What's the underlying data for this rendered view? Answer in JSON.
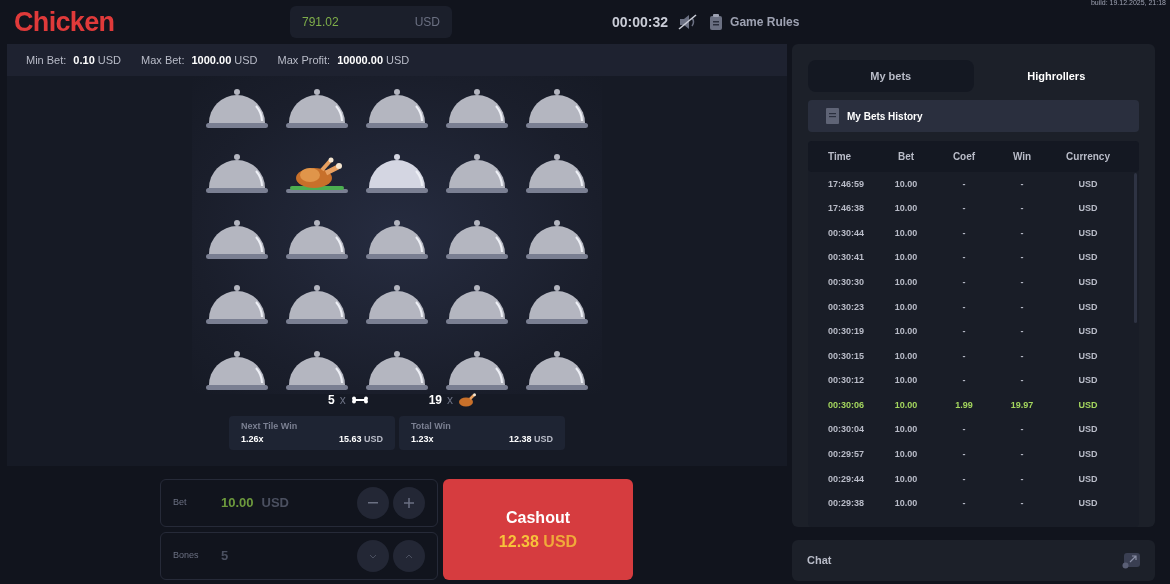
{
  "header": {
    "logo": "Chicken",
    "balance": {
      "amount": "791.02",
      "currency": "USD"
    },
    "timer": "00:00:32",
    "sound_muted": true,
    "rules_link": "Game Rules",
    "build": "build: 19.12.2025, 21:18"
  },
  "limits": [
    {
      "label": "Min Bet:",
      "value": "0.10",
      "currency": "USD"
    },
    {
      "label": "Max Bet:",
      "value": "1000.00",
      "currency": "USD"
    },
    {
      "label": "Max Profit:",
      "value": "10000.00",
      "currency": "USD"
    }
  ],
  "tiles": [
    {
      "kind": "dome"
    },
    {
      "kind": "dome"
    },
    {
      "kind": "dome"
    },
    {
      "kind": "dome"
    },
    {
      "kind": "dome"
    },
    {
      "kind": "dome"
    },
    {
      "kind": "chicken"
    },
    {
      "kind": "hovered"
    },
    {
      "kind": "dome"
    },
    {
      "kind": "dome"
    },
    {
      "kind": "dome"
    },
    {
      "kind": "dome"
    },
    {
      "kind": "dome"
    },
    {
      "kind": "dome"
    },
    {
      "kind": "dome"
    },
    {
      "kind": "dome"
    },
    {
      "kind": "dome"
    },
    {
      "kind": "dome"
    },
    {
      "kind": "dome"
    },
    {
      "kind": "dome"
    },
    {
      "kind": "dome"
    },
    {
      "kind": "dome"
    },
    {
      "kind": "dome"
    },
    {
      "kind": "dome"
    },
    {
      "kind": "dome"
    }
  ],
  "counts": [
    {
      "kind": "bone",
      "count": "5",
      "times": "x"
    },
    {
      "kind": "chicken",
      "count": "19",
      "times": "x"
    }
  ],
  "wins": [
    {
      "label": "Next Tile Win",
      "coef": "1.26x",
      "amount": "15.63",
      "currency": "USD"
    },
    {
      "label": "Total Win",
      "coef": "1.23x",
      "amount": "12.38",
      "currency": "USD"
    }
  ],
  "bet": {
    "label": "Bet",
    "value": "10.00",
    "currency": "USD"
  },
  "bones": {
    "label": "Bones",
    "value": "5"
  },
  "cashout": {
    "label": "Cashout",
    "amount": "12.38",
    "currency": "USD"
  },
  "tabs": [
    {
      "label": "My bets",
      "selected": true
    },
    {
      "label": "Highrollers",
      "selected": false
    }
  ],
  "history_title": "My Bets History",
  "table": {
    "columns": [
      "Time",
      "Bet",
      "Coef",
      "Win",
      "Currency"
    ],
    "rows": [
      {
        "cells": [
          "17:46:59",
          "10.00",
          "-",
          "-",
          "USD"
        ],
        "won": false
      },
      {
        "cells": [
          "17:46:38",
          "10.00",
          "-",
          "-",
          "USD"
        ],
        "won": false
      },
      {
        "cells": [
          "00:30:44",
          "10.00",
          "-",
          "-",
          "USD"
        ],
        "won": false
      },
      {
        "cells": [
          "00:30:41",
          "10.00",
          "-",
          "-",
          "USD"
        ],
        "won": false
      },
      {
        "cells": [
          "00:30:30",
          "10.00",
          "-",
          "-",
          "USD"
        ],
        "won": false
      },
      {
        "cells": [
          "00:30:23",
          "10.00",
          "-",
          "-",
          "USD"
        ],
        "won": false
      },
      {
        "cells": [
          "00:30:19",
          "10.00",
          "-",
          "-",
          "USD"
        ],
        "won": false
      },
      {
        "cells": [
          "00:30:15",
          "10.00",
          "-",
          "-",
          "USD"
        ],
        "won": false
      },
      {
        "cells": [
          "00:30:12",
          "10.00",
          "-",
          "-",
          "USD"
        ],
        "won": false
      },
      {
        "cells": [
          "00:30:06",
          "10.00",
          "1.99",
          "19.97",
          "USD"
        ],
        "won": true
      },
      {
        "cells": [
          "00:30:04",
          "10.00",
          "-",
          "-",
          "USD"
        ],
        "won": false
      },
      {
        "cells": [
          "00:29:57",
          "10.00",
          "-",
          "-",
          "USD"
        ],
        "won": false
      },
      {
        "cells": [
          "00:29:44",
          "10.00",
          "-",
          "-",
          "USD"
        ],
        "won": false
      },
      {
        "cells": [
          "00:29:38",
          "10.00",
          "-",
          "-",
          "USD"
        ],
        "won": false
      }
    ]
  },
  "chat": {
    "title": "Chat"
  }
}
